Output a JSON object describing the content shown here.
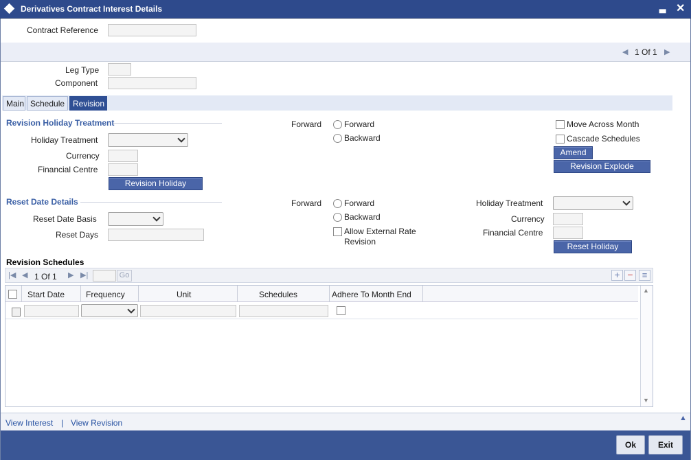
{
  "window": {
    "title": "Derivatives Contract Interest Details",
    "minimize": "▃",
    "close": "✕"
  },
  "header": {
    "contract_reference_label": "Contract Reference",
    "contract_reference_value": "",
    "pager": {
      "prev": "◀",
      "text": "1 Of 1",
      "next": "▶"
    }
  },
  "leg": {
    "leg_type_label": "Leg Type",
    "leg_type_value": "",
    "component_label": "Component",
    "component_value": ""
  },
  "tabs": [
    {
      "label": "Main",
      "active": false
    },
    {
      "label": "Schedule",
      "active": false
    },
    {
      "label": "Revision",
      "active": true
    }
  ],
  "revision_holiday": {
    "section_title": "Revision Holiday Treatment",
    "holiday_treatment_label": "Holiday Treatment",
    "holiday_treatment_value": "",
    "currency_label": "Currency",
    "currency_value": "",
    "financial_centre_label": "Financial Centre",
    "financial_centre_value": "",
    "button": "Revision Holiday",
    "forward_label": "Forward",
    "radio_forward": "Forward",
    "radio_backward": "Backward",
    "move_across_month": "Move Across Month",
    "cascade_schedules": "Cascade Schedules",
    "amend_button": "Amend",
    "explode_button": "Revision Explode"
  },
  "reset_date": {
    "section_title": "Reset Date Details",
    "basis_label": "Reset Date Basis",
    "basis_value": "",
    "days_label": "Reset Days",
    "days_value": "",
    "forward_label": "Forward",
    "radio_forward": "Forward",
    "radio_backward": "Backward",
    "allow_external_line1": "Allow External Rate",
    "allow_external_line2": "Revision",
    "holiday_treatment_label": "Holiday Treatment",
    "holiday_treatment_value": "",
    "currency_label": "Currency",
    "currency_value": "",
    "financial_centre_label": "Financial Centre",
    "financial_centre_value": "",
    "button": "Reset Holiday"
  },
  "schedules": {
    "title": "Revision Schedules",
    "pager_text": "1 Of 1",
    "go": "Go",
    "add": "+",
    "remove": "−",
    "detail": "≡",
    "columns": [
      "Start Date",
      "Frequency",
      "Unit",
      "Schedules",
      "Adhere To Month End"
    ],
    "scroll_up": "▲",
    "scroll_down": "▼"
  },
  "links": {
    "view_interest": "View Interest",
    "separator": "|",
    "view_revision": "View Revision"
  },
  "footer": {
    "ok": "Ok",
    "exit": "Exit",
    "collapse": "▲"
  }
}
